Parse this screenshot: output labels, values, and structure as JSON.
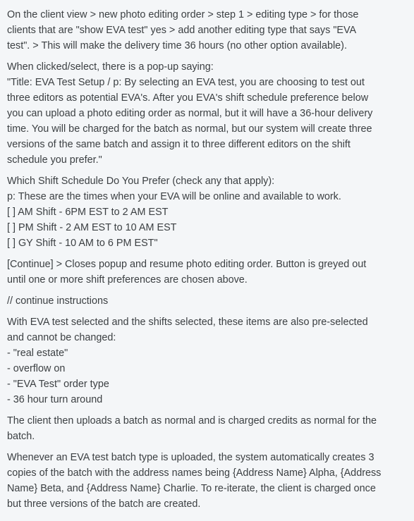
{
  "paragraphs": [
    {
      "lines": [
        "On the client view > new photo editing order > step 1 > editing type > for those",
        "clients that are \"show EVA test\" yes > add another editing type that says \"EVA",
        "test\". > This will make the delivery time 36 hours (no other option available)."
      ]
    },
    {
      "lines": [
        "When clicked/select, there is a pop-up saying:",
        "\"Title: EVA Test Setup / p: By selecting an EVA test, you are choosing to test out",
        "three editors as potential EVA's. After you EVA's shift schedule preference below",
        "you can upload a photo editing order as normal, but it will have a 36-hour delivery",
        "time. You will be charged for the batch as normal, but our system will create three",
        "versions of the same batch and assign it to three different editors on the shift",
        "schedule you prefer.\""
      ]
    },
    {
      "lines": [
        "Which Shift Schedule Do You Prefer (check any that apply):",
        "p: These are the times when your EVA will be online and available to work.",
        "[ ] AM Shift - 6PM EST to 2 AM EST",
        "[ ] PM Shift - 2 AM EST to 10 AM EST",
        "[ ] GY Shift - 10 AM to 6 PM EST\""
      ]
    },
    {
      "lines": [
        "[Continue] > Closes popup and resume photo editing order. Button is greyed out",
        "until one or more shift preferences are chosen above."
      ]
    },
    {
      "lines": [
        "// continue instructions"
      ]
    },
    {
      "lines": [
        "With EVA test selected and the shifts selected, these items are also pre-selected",
        "and cannot be changed:",
        "- \"real estate\"",
        "- overflow on",
        "- \"EVA Test\" order type",
        "- 36 hour turn around"
      ]
    },
    {
      "lines": [
        "The client then uploads a batch as normal and is charged credits as normal for the",
        "batch."
      ]
    },
    {
      "lines": [
        "Whenever an EVA test batch type is uploaded, the system automatically creates 3",
        "copies of the batch with the address names being {Address Name} Alpha, {Address",
        "Name} Beta, and {Address Name} Charlie. To re-iterate, the client is charged once",
        "but three versions of the batch are created."
      ]
    }
  ]
}
